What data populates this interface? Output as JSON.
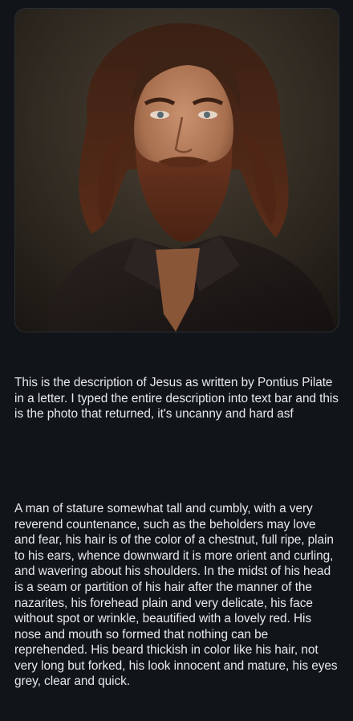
{
  "post": {
    "image_alt_icon": "portrait-photo",
    "caption_intro": "This is the description of Jesus as written by Pontius Pilate in a letter. I typed the entire description into text bar and this is the photo that returned, it's uncanny and hard asf",
    "caption_quote": "A man of stature somewhat tall and cumbly, with a very reverend countenance, such as the beholders may love and fear, his hair is of the color of a chestnut, full ripe, plain to his ears, whence downward it is more orient and curling, and wavering about his shoulders. In the midst of his head is a seam or partition of his hair after the manner of the nazarites, his forehead plain and very delicate, his face without spot or wrinkle, beautified with a lovely red. His nose and mouth so formed that nothing can be reprehended. His beard thickish in color like his hair, not very long but forked, his look innocent and mature, his eyes grey, clear and quick."
  },
  "colors": {
    "background": "#111519",
    "text": "#e7e9ea",
    "card_border": "#2a2f34"
  }
}
